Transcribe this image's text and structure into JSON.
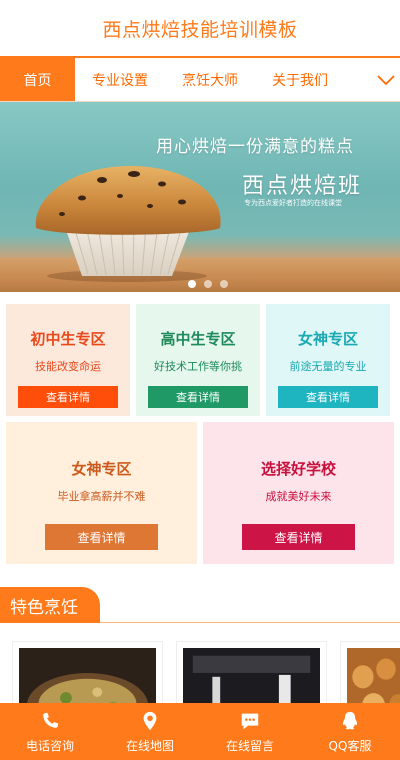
{
  "header": {
    "title": "西点烘焙技能培训模板"
  },
  "nav": {
    "tabs": [
      "首页",
      "专业设置",
      "烹饪大师",
      "关于我们"
    ],
    "more_icon": "chevron-down-icon"
  },
  "banner": {
    "slogan": "用心烘焙一份满意的糕点",
    "headline": "西点烘焙班",
    "tagline": "专为西点爱好者打造的在线课堂",
    "slide_count": 3,
    "active_slide": 0
  },
  "cards": [
    {
      "title": "初中生专区",
      "subtitle": "技能改变命运",
      "button": "查看详情",
      "bg": "#fde8dc",
      "accent": "#e8491b",
      "btn": "#ff4d0a"
    },
    {
      "title": "高中生专区",
      "subtitle": "好技术工作等你挑",
      "button": "查看详情",
      "bg": "#e6f7ee",
      "accent": "#1d8a5a",
      "btn": "#1f9a66"
    },
    {
      "title": "女神专区",
      "subtitle": "前途无量的专业",
      "button": "查看详情",
      "bg": "#dff7f6",
      "accent": "#18a9b3",
      "btn": "#1fb5c0"
    },
    {
      "title": "女神专区",
      "subtitle": "毕业拿高薪并不难",
      "button": "查看详情",
      "bg": "#ffefdc",
      "accent": "#cc5a1e",
      "btn": "#de7634"
    },
    {
      "title": "选择好学校",
      "subtitle": "成就美好未来",
      "button": "查看详情",
      "bg": "#fde4ea",
      "accent": "#c8103e",
      "btn": "#cc1447"
    }
  ],
  "section": {
    "title": "特色烹饪"
  },
  "bottom_bar": [
    {
      "label": "电话咨询",
      "icon": "phone-icon"
    },
    {
      "label": "在线地图",
      "icon": "map-pin-icon"
    },
    {
      "label": "在线留言",
      "icon": "message-icon"
    },
    {
      "label": "QQ客服",
      "icon": "qq-penguin-icon"
    }
  ],
  "colors": {
    "brand": "#ff7a1a",
    "brand_text": "#ff6a00"
  }
}
